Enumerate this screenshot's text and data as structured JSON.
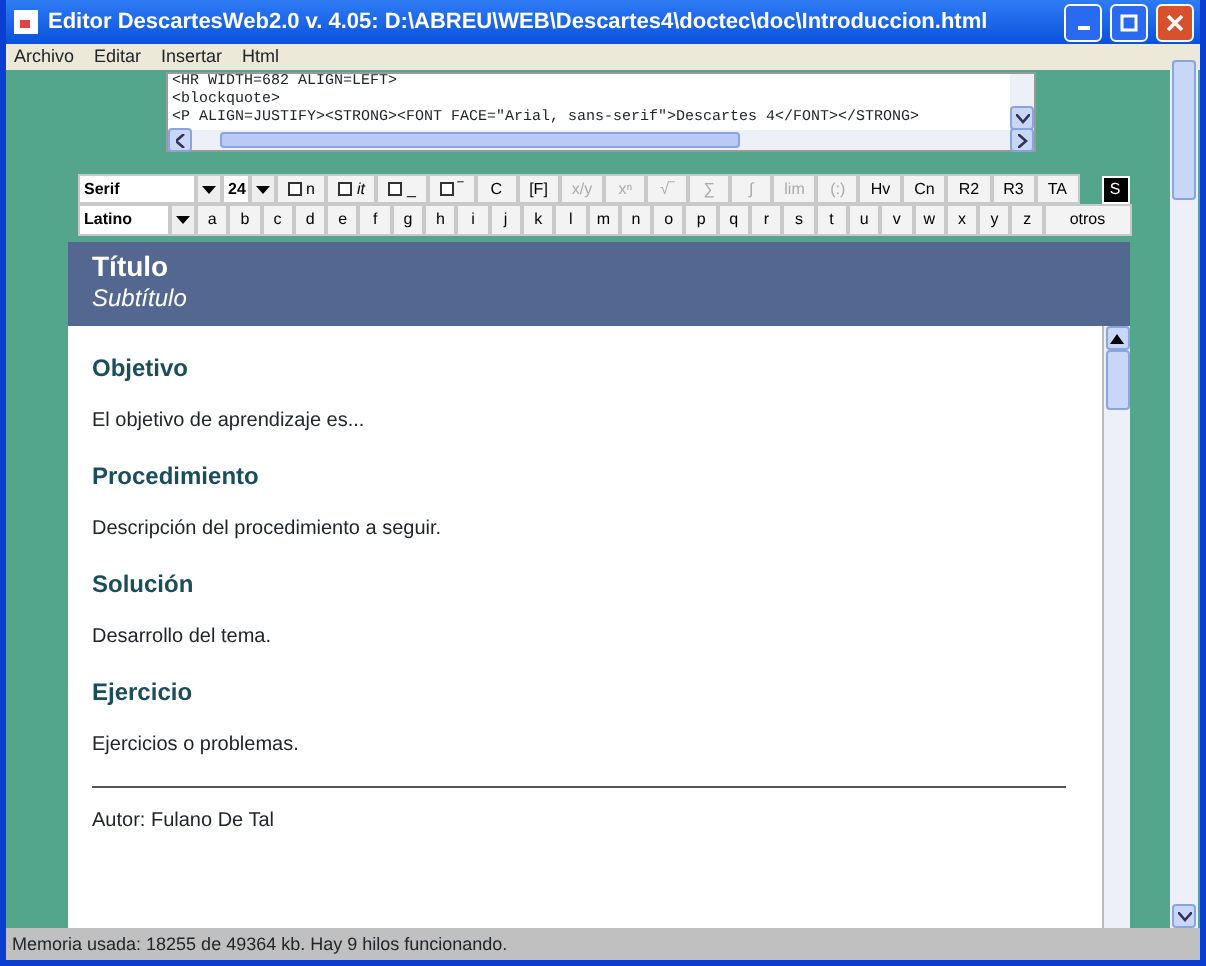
{
  "window": {
    "title": "Editor DescartesWeb2.0 v. 4.05: D:\\ABREU\\WEB\\Descartes4\\doctec\\doc\\Introduccion.html"
  },
  "menu": [
    "Archivo",
    "Editar",
    "Insertar",
    "Html"
  ],
  "source_lines": [
    "<HR WIDTH=682 ALIGN=LEFT>",
    "<blockquote>",
    "<P ALIGN=JUSTIFY><STRONG><FONT FACE=\"Arial, sans-serif\">Descartes 4</FONT></STRONG>"
  ],
  "toolbar": [
    {
      "kind": "combo",
      "label": "Serif"
    },
    {
      "kind": "combo",
      "label": "24"
    },
    {
      "kind": "check",
      "label": "n",
      "checked": false
    },
    {
      "kind": "check",
      "label": "it",
      "checked": false
    },
    {
      "kind": "check",
      "label": "_",
      "checked": false
    },
    {
      "kind": "check",
      "label": "‾",
      "checked": false
    },
    {
      "kind": "button",
      "label": "C",
      "disabled": false
    },
    {
      "kind": "button",
      "label": "[F]",
      "disabled": false
    },
    {
      "kind": "button",
      "label": "x/y",
      "disabled": true
    },
    {
      "kind": "button",
      "label": "xⁿ",
      "disabled": true
    },
    {
      "kind": "button",
      "label": "√‾",
      "disabled": true
    },
    {
      "kind": "button",
      "label": "∑",
      "disabled": true
    },
    {
      "kind": "button",
      "label": "∫",
      "disabled": true
    },
    {
      "kind": "button",
      "label": "lim",
      "disabled": true
    },
    {
      "kind": "button",
      "label": "(:)",
      "disabled": true
    },
    {
      "kind": "button",
      "label": "Hv",
      "disabled": false
    },
    {
      "kind": "button",
      "label": "Cn",
      "disabled": false
    },
    {
      "kind": "button",
      "label": "R2",
      "disabled": false
    },
    {
      "kind": "button",
      "label": "R3",
      "disabled": false
    },
    {
      "kind": "button",
      "label": "TA",
      "disabled": false
    }
  ],
  "special_button": "S",
  "alphabet": {
    "combo": "Latino",
    "letters": [
      "a",
      "b",
      "c",
      "d",
      "e",
      "f",
      "g",
      "h",
      "i",
      "j",
      "k",
      "l",
      "m",
      "n",
      "o",
      "p",
      "q",
      "r",
      "s",
      "t",
      "u",
      "v",
      "w",
      "x",
      "y",
      "z"
    ],
    "more": "otros"
  },
  "document": {
    "title": "Título",
    "subtitle": "Subtítulo",
    "sections": [
      {
        "heading": "Objetivo",
        "text": "El objetivo de aprendizaje es..."
      },
      {
        "heading": "Procedimiento",
        "text": "Descripción del procedimiento a seguir."
      },
      {
        "heading": "Solución",
        "text": "Desarrollo del tema."
      },
      {
        "heading": "Ejercicio",
        "text": "Ejercicios o problemas."
      }
    ],
    "author": "Autor: Fulano De Tal"
  },
  "status_bar": "Memoria usada: 18255 de 49364 kb. Hay 9 hilos funcionando."
}
